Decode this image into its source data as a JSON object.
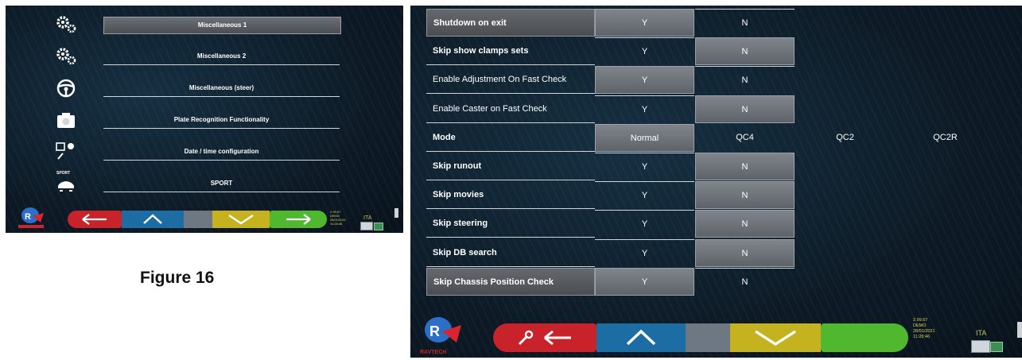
{
  "left_menu": {
    "items": [
      {
        "label": "Miscellaneous 1",
        "icon": "gears-icon",
        "selected": true
      },
      {
        "label": "Miscellaneous 2",
        "icon": "gears-icon",
        "selected": false
      },
      {
        "label": "Miscellaneous (steer)",
        "icon": "steering-wheel-icon",
        "selected": false
      },
      {
        "label": "Plate Recognition Functionality",
        "icon": "camera-icon",
        "selected": false
      },
      {
        "label": "Date / time configuration",
        "icon": "calendar-clock-icon",
        "selected": false
      },
      {
        "label": "SPORT",
        "icon": "sport-car-icon",
        "selected": false
      }
    ],
    "sport_icon_text": "SPORT"
  },
  "status": {
    "version": "2.99.67",
    "mode": "DEMO",
    "date": "28/01/2021",
    "time_left": "11:28:46",
    "time_right": "11:28:46",
    "language": "ITA"
  },
  "caption": "Figure 16",
  "settings": {
    "rows": [
      {
        "label": "Shutdown on exit",
        "bold": true,
        "options": [
          "Y",
          "N"
        ],
        "selected": 0
      },
      {
        "label": "Skip show clamps sets",
        "bold": true,
        "options": [
          "Y",
          "N"
        ],
        "selected": 1
      },
      {
        "label": "Enable Adjustment On Fast Check",
        "bold": false,
        "options": [
          "Y",
          "N"
        ],
        "selected": 0
      },
      {
        "label": "Enable Caster on Fast Check",
        "bold": false,
        "options": [
          "Y",
          "N"
        ],
        "selected": 1
      },
      {
        "label": "Mode",
        "bold": true,
        "options": [
          "Normal",
          "QC4",
          "QC2",
          "QC2R"
        ],
        "selected": 0
      },
      {
        "label": "Skip runout",
        "bold": true,
        "options": [
          "Y",
          "N"
        ],
        "selected": 1
      },
      {
        "label": "Skip movies",
        "bold": true,
        "options": [
          "Y",
          "N"
        ],
        "selected": 1
      },
      {
        "label": "Skip steering",
        "bold": true,
        "options": [
          "Y",
          "N"
        ],
        "selected": 1
      },
      {
        "label": "Skip DB search",
        "bold": true,
        "options": [
          "Y",
          "N"
        ],
        "selected": 1
      },
      {
        "label": "Skip Chassis Position Check",
        "bold": true,
        "options": [
          "Y",
          "N"
        ],
        "selected": 0
      }
    ]
  },
  "logo_text": "RAVTECH",
  "colors": {
    "red": "#c8222a",
    "blue": "#1c6da3",
    "gray": "#6e7882",
    "yellow": "#c4b31e",
    "green": "#4fb82f"
  }
}
